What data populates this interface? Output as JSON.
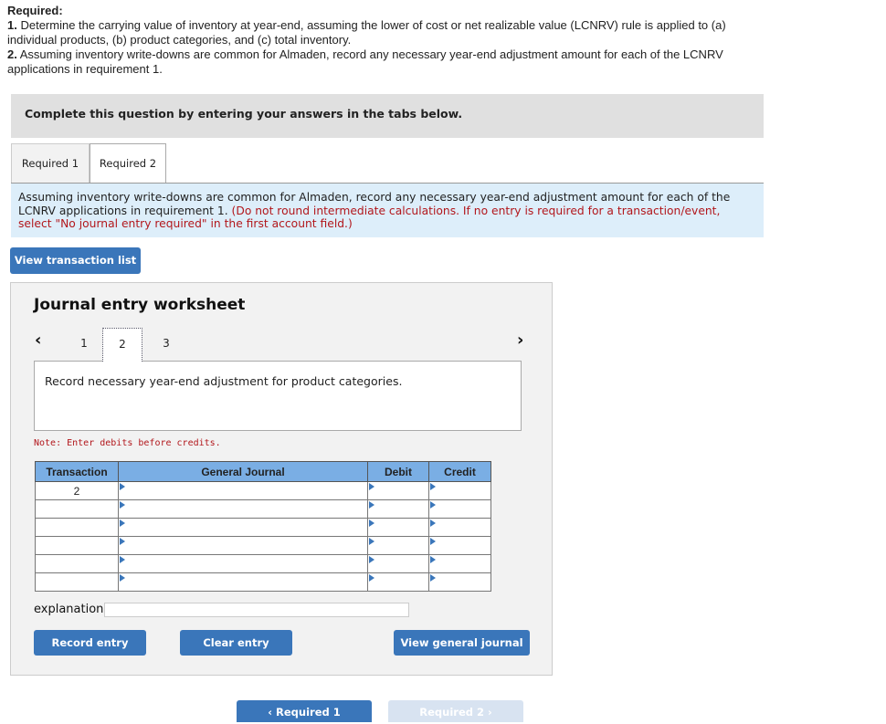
{
  "requirements": {
    "heading": "Required:",
    "items": [
      {
        "num": "1.",
        "text": "Determine the carrying value of inventory at year-end, assuming the lower of cost or net realizable value (LCNRV) rule is applied to (a) individual products, (b) product categories, and (c) total inventory."
      },
      {
        "num": "2.",
        "text": "Assuming inventory write-downs are common for Almaden, record any necessary year-end adjustment amount for each of the LCNRV applications in requirement 1."
      }
    ]
  },
  "banner": "Complete this question by entering your answers in the tabs below.",
  "tabs": [
    {
      "label": "Required 1",
      "active": false
    },
    {
      "label": "Required 2",
      "active": true
    }
  ],
  "instructions": {
    "text": "Assuming inventory write-downs are common for Almaden, record any necessary year-end adjustment amount for each of the LCNRV applications in requirement 1.",
    "note": "(Do not round intermediate calculations. If no entry is required for a transaction/event, select \"No journal entry required\" in the first account field.)"
  },
  "view_transaction_list": "View transaction list",
  "worksheet": {
    "title": "Journal entry worksheet",
    "prev_icon": "‹",
    "next_icon": "›",
    "pages": [
      "1",
      "2",
      "3"
    ],
    "active_page": "2",
    "description": "Record necessary year-end adjustment for product categories.",
    "note": "Note: Enter debits before credits.",
    "table": {
      "headers": [
        "Transaction",
        "General Journal",
        "Debit",
        "Credit"
      ],
      "rows": [
        {
          "transaction": "2",
          "account": "",
          "debit": "",
          "credit": ""
        },
        {
          "transaction": "",
          "account": "",
          "debit": "",
          "credit": ""
        },
        {
          "transaction": "",
          "account": "",
          "debit": "",
          "credit": ""
        },
        {
          "transaction": "",
          "account": "",
          "debit": "",
          "credit": ""
        },
        {
          "transaction": "",
          "account": "",
          "debit": "",
          "credit": ""
        },
        {
          "transaction": "",
          "account": "",
          "debit": "",
          "credit": ""
        }
      ]
    },
    "explanation_label": "explanation",
    "explanation_value": "",
    "buttons": {
      "record": "Record entry",
      "clear": "Clear entry",
      "view_journal": "View general journal"
    }
  },
  "bottom_nav": {
    "prev": "‹  Required 1",
    "next": "Required 2  ›"
  }
}
